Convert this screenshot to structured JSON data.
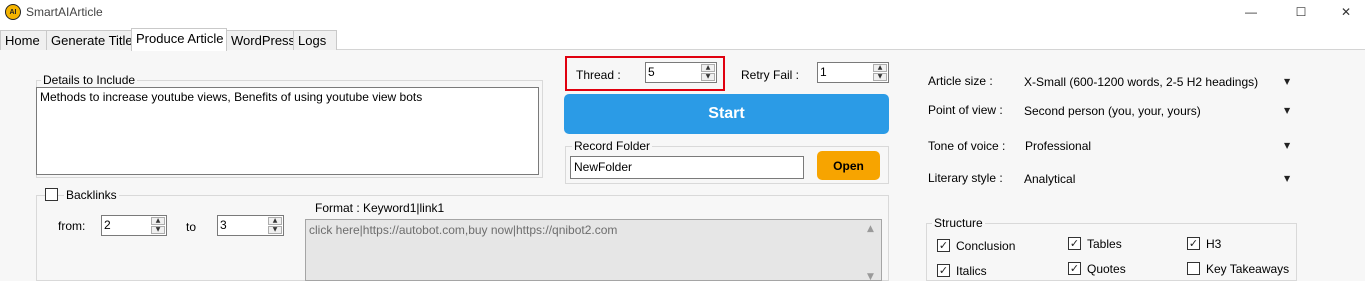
{
  "window": {
    "title": "SmartAIArticle",
    "icon_text": "AI",
    "minimize": "—",
    "maximize": "☐",
    "close": "✕"
  },
  "tabs": [
    {
      "label": "Home"
    },
    {
      "label": "Generate Title"
    },
    {
      "label": "Produce Article",
      "active": true
    },
    {
      "label": "WordPress"
    },
    {
      "label": "Logs"
    }
  ],
  "details": {
    "legend": "Details to Include",
    "value": "Methods to increase youtube views, Benefits of using youtube view bots"
  },
  "thread": {
    "label": "Thread :",
    "value": "5"
  },
  "retry_fail": {
    "label": "Retry Fail :",
    "value": "1"
  },
  "start_button": "Start",
  "record_folder": {
    "legend": "Record Folder",
    "value": "NewFolder",
    "open_label": "Open"
  },
  "backlinks": {
    "label": "Backlinks",
    "checked": false,
    "from_label": "from:",
    "from_value": "2",
    "to_label": "to",
    "to_value": "3",
    "format_label": "Format : Keyword1|link1",
    "text": "click here|https://autobot.com,buy now|https://qnibot2.com"
  },
  "settings": [
    {
      "label": "Article size :",
      "value": "X-Small (600-1200 words, 2-5 H2 headings)"
    },
    {
      "label": "Point of view :",
      "value": "Second person (you, your, yours)"
    },
    {
      "label": "Tone of voice :",
      "value": "Professional"
    },
    {
      "label": "Literary style :",
      "value": "Analytical"
    }
  ],
  "structure": {
    "legend": "Structure",
    "items": [
      {
        "label": "Conclusion",
        "checked": true
      },
      {
        "label": "Tables",
        "checked": true
      },
      {
        "label": "H3",
        "checked": true
      },
      {
        "label": "Italics",
        "checked": true
      },
      {
        "label": "Quotes",
        "checked": true
      },
      {
        "label": "Key Takeaways",
        "checked": false
      }
    ]
  },
  "colors": {
    "start_button": "#2b9be6",
    "open_button": "#f7a400",
    "highlight": "#e0000f"
  }
}
